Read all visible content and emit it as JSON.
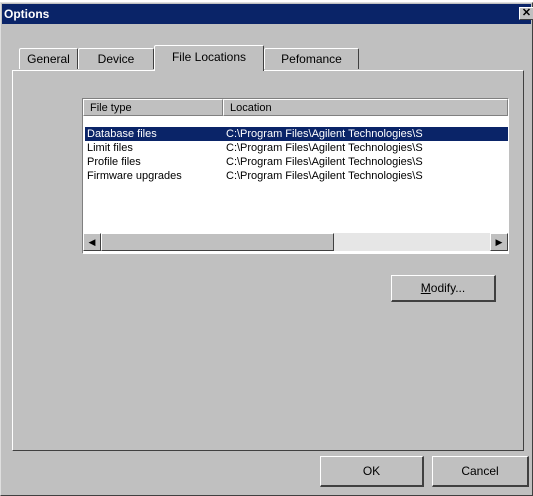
{
  "window": {
    "title": "Options",
    "close_glyph": "✕"
  },
  "tabs": [
    {
      "label": "General",
      "active": false
    },
    {
      "label": "Device",
      "active": false
    },
    {
      "label": "File Locations",
      "active": true
    },
    {
      "label": "Pefomance",
      "active": false
    }
  ],
  "list": {
    "columns": [
      "File type",
      "Location"
    ],
    "rows": [
      {
        "type": "Database files",
        "location": "C:\\Program Files\\Agilent Technologies\\S",
        "selected": true
      },
      {
        "type": "Limit files",
        "location": "C:\\Program Files\\Agilent Technologies\\S",
        "selected": false
      },
      {
        "type": "Profile files",
        "location": "C:\\Program Files\\Agilent Technologies\\S",
        "selected": false
      },
      {
        "type": "Firmware upgrades",
        "location": "C:\\Program Files\\Agilent Technologies\\S",
        "selected": false
      }
    ],
    "scroll": {
      "left_glyph": "◀",
      "right_glyph": "▶"
    }
  },
  "buttons": {
    "modify": "Modify...",
    "ok": "OK",
    "cancel": "Cancel"
  },
  "icons": {
    "cursor": "arrow-cursor-icon"
  },
  "colors": {
    "titlebar": "#0a2468",
    "face": "#c0c0c0",
    "selection": "#0a2468"
  }
}
